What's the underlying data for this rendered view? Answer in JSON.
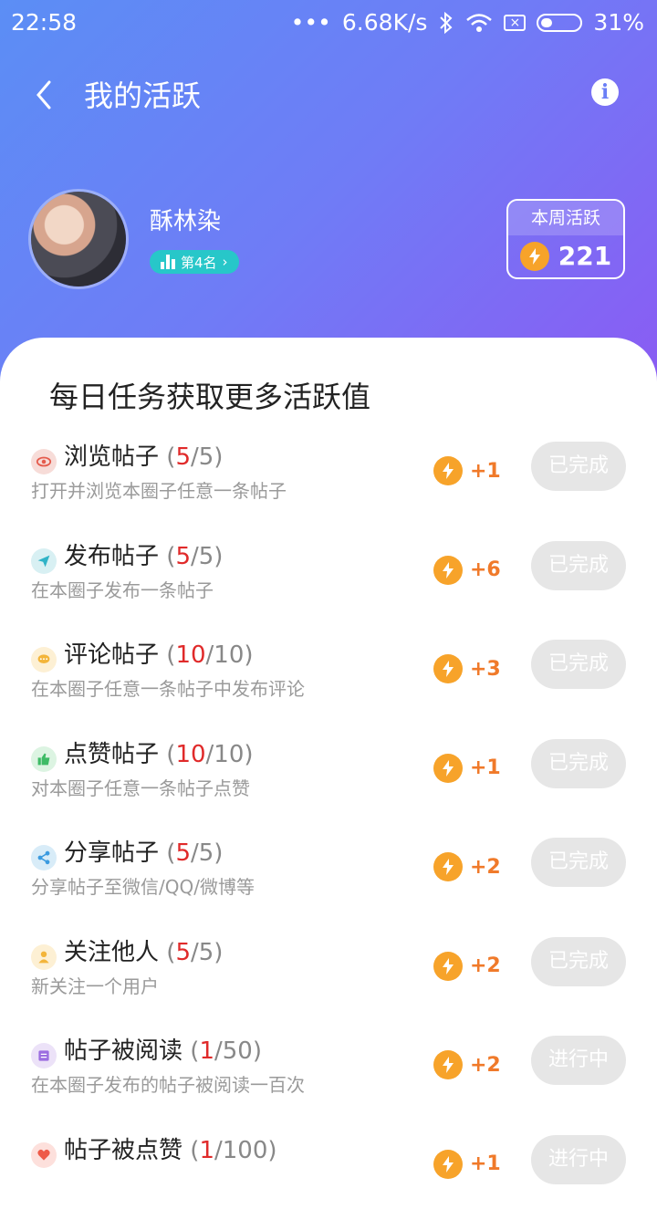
{
  "status_bar": {
    "time": "22:58",
    "dots": "•••",
    "speed": "6.68K/s",
    "battery": "31%",
    "battery_level": 0.31
  },
  "header": {
    "title": "我的活跃"
  },
  "profile": {
    "name": "酥林染",
    "rank": "第4名"
  },
  "weekly": {
    "label": "本周活跃",
    "value": "221"
  },
  "tasks_title": "每日任务获取更多活跃值",
  "tasks": [
    {
      "name": "浏览帖子",
      "done": "5",
      "total": "/5)",
      "desc": "打开并浏览本圈子任意一条帖子",
      "reward": "+1",
      "status": "已完成",
      "icon": "eye-icon",
      "icon_color": "#f7dcd8",
      "glyph_color": "#e55b4c"
    },
    {
      "name": "发布帖子",
      "done": "5",
      "total": "/5)",
      "desc": "在本圈子发布一条帖子",
      "reward": "+6",
      "status": "已完成",
      "icon": "send-icon",
      "icon_color": "#d8f0f3",
      "glyph_color": "#2fb3c7"
    },
    {
      "name": "评论帖子",
      "done": "10",
      "total": "/10)",
      "desc": "在本圈子任意一条帖子中发布评论",
      "reward": "+3",
      "status": "已完成",
      "icon": "comment-icon",
      "icon_color": "#fdf0d4",
      "glyph_color": "#f3b53a"
    },
    {
      "name": "点赞帖子",
      "done": "10",
      "total": "/10)",
      "desc": "对本圈子任意一条帖子点赞",
      "reward": "+1",
      "status": "已完成",
      "icon": "thumbs-up-icon",
      "icon_color": "#dcf4e2",
      "glyph_color": "#3dbb65"
    },
    {
      "name": "分享帖子",
      "done": "5",
      "total": "/5)",
      "desc": "分享帖子至微信/QQ/微博等",
      "reward": "+2",
      "status": "已完成",
      "icon": "share-icon",
      "icon_color": "#d8ecf8",
      "glyph_color": "#3b9be0"
    },
    {
      "name": "关注他人",
      "done": "5",
      "total": "/5)",
      "desc": "新关注一个用户",
      "reward": "+2",
      "status": "已完成",
      "icon": "user-icon",
      "icon_color": "#fdf0d4",
      "glyph_color": "#f3b53a"
    },
    {
      "name": "帖子被阅读",
      "done": "1",
      "total": "/50)",
      "desc": "在本圈子发布的帖子被阅读一百次",
      "reward": "+2",
      "status": "进行中",
      "icon": "book-icon",
      "icon_color": "#ece2f8",
      "glyph_color": "#9b6de0"
    },
    {
      "name": "帖子被点赞",
      "done": "1",
      "total": "/100)",
      "desc": "",
      "reward": "+1",
      "status": "进行中",
      "icon": "heart-icon",
      "icon_color": "#fde0dc",
      "glyph_color": "#ee5a48"
    }
  ]
}
